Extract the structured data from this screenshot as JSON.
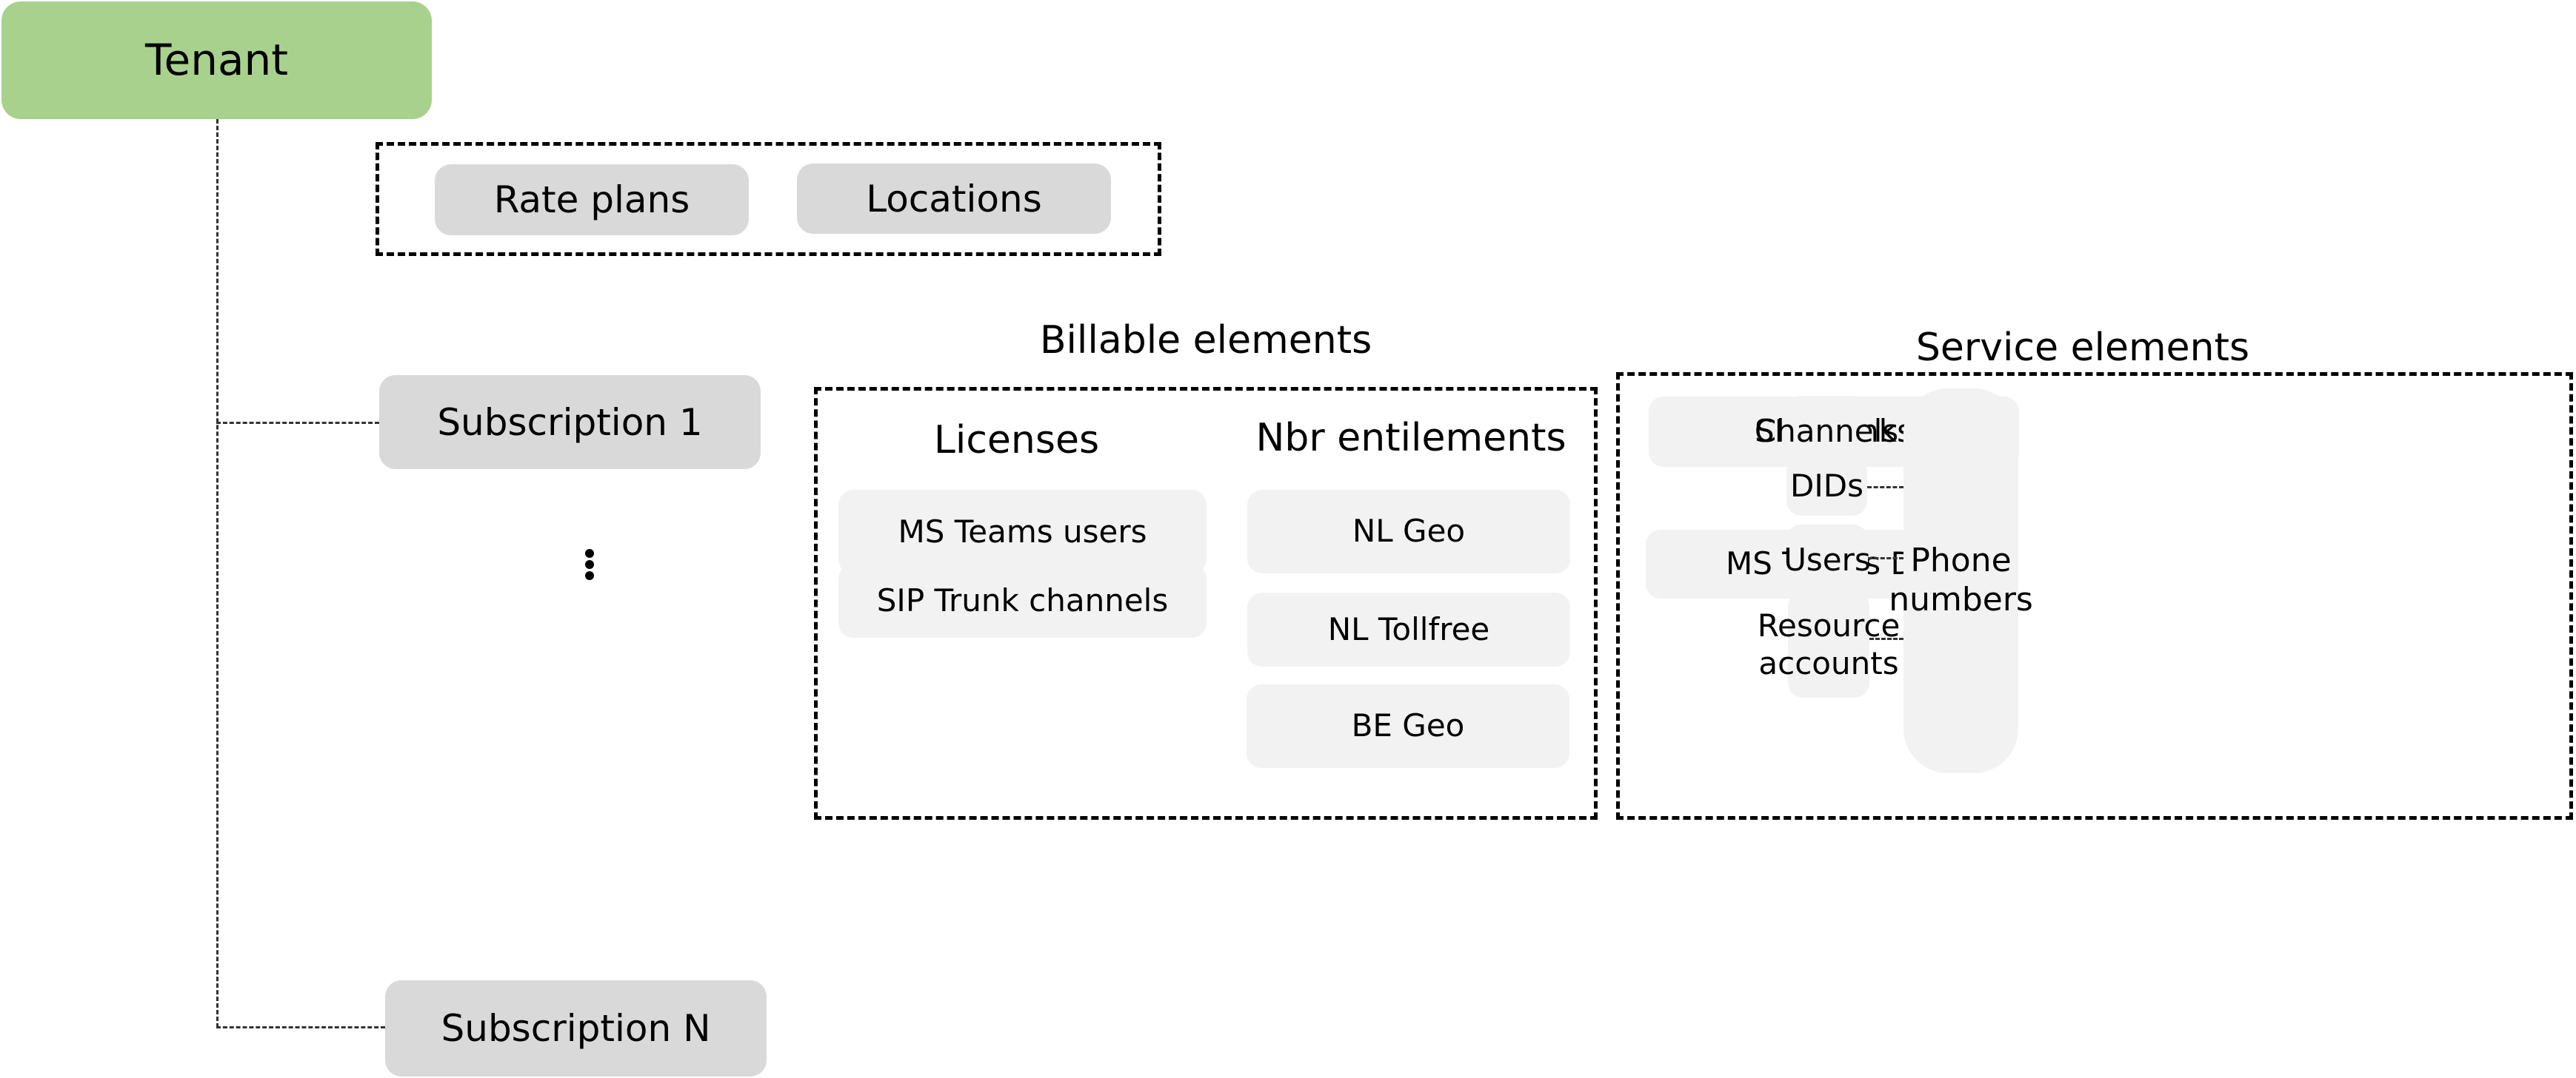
{
  "tenant": {
    "label": "Tenant",
    "color": "#A9D18E"
  },
  "tenant_shared": {
    "items": [
      {
        "label": "Rate plans"
      },
      {
        "label": "Locations"
      }
    ]
  },
  "subscriptions": {
    "first": {
      "label": "Subscription 1"
    },
    "ellipsis": "⋮",
    "last": {
      "label": "Subscription N"
    }
  },
  "billable": {
    "title": "Billable elements",
    "licenses": {
      "heading": "Licenses",
      "items": [
        {
          "label": "MS Teams users"
        },
        {
          "label": "SIP Trunk channels"
        }
      ]
    },
    "nbr_entitlements": {
      "heading": "Nbr entilements",
      "items": [
        {
          "label": "NL Geo"
        },
        {
          "label": "NL Tollfree"
        },
        {
          "label": "BE Geo"
        }
      ]
    }
  },
  "service": {
    "title": "Service elements",
    "services": [
      {
        "label": "SIP Trunks"
      },
      {
        "label": "MS Teams  DR"
      }
    ],
    "sub_elements": [
      {
        "label": "Channels"
      },
      {
        "label": "DIDs"
      },
      {
        "label": "Users"
      },
      {
        "label": "Resource accounts"
      }
    ],
    "phone_numbers": {
      "label": "Phone numbers"
    }
  },
  "colors": {
    "tenant": "#A9D18E",
    "primary_box": "#D9D9D9",
    "secondary_box": "#F2F2F2",
    "border": "#000000"
  }
}
